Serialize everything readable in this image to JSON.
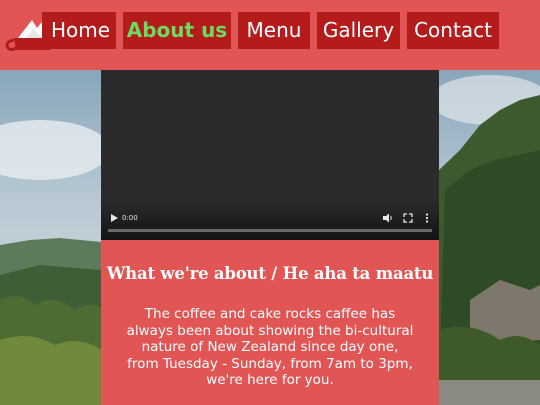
{
  "brand": {
    "logo_icon": "coffee-cup-mountain-icon"
  },
  "nav": {
    "items": [
      {
        "label": "Home",
        "active": false
      },
      {
        "label": "About us",
        "active": true
      },
      {
        "label": "Menu",
        "active": false
      },
      {
        "label": "Gallery",
        "active": false
      },
      {
        "label": "Contact",
        "active": false
      }
    ]
  },
  "video": {
    "current_time": "0:00",
    "progress": 0.0,
    "icons": [
      "play-icon",
      "volume-icon",
      "fullscreen-icon",
      "more-options-icon"
    ]
  },
  "about": {
    "heading": "What we're about / He aha ta maatu",
    "body": "The coffee and cake rocks caffee has always been about showing the bi-cultural nature of New Zealand since day one, from Tuesday - Sunday, from 7am to 3pm, we're here for you."
  },
  "colors": {
    "header_bg": "#e25555",
    "nav_bg": "#b41c1c",
    "nav_active_text": "#6bdc5f",
    "card_bg": "#e25555"
  }
}
